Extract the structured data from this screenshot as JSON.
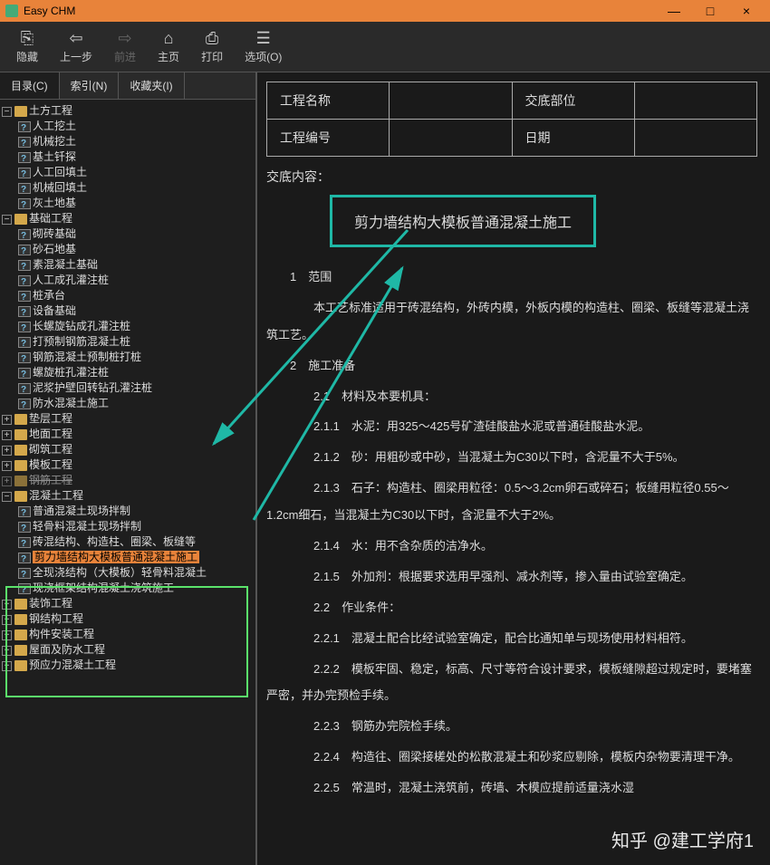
{
  "window": {
    "title": "Easy CHM",
    "min": "—",
    "max": "□",
    "close": "×"
  },
  "toolbar": [
    {
      "id": "hide",
      "label": "隐藏",
      "glyph": "⎘",
      "disabled": false
    },
    {
      "id": "back",
      "label": "上一步",
      "glyph": "⇦",
      "disabled": false
    },
    {
      "id": "fwd",
      "label": "前进",
      "glyph": "⇨",
      "disabled": true
    },
    {
      "id": "home",
      "label": "主页",
      "glyph": "⌂",
      "disabled": false
    },
    {
      "id": "print",
      "label": "打印",
      "glyph": "⎙",
      "disabled": false
    },
    {
      "id": "opts",
      "label": "选项(O)",
      "glyph": "☰",
      "disabled": false
    }
  ],
  "tabs": [
    {
      "id": "contents",
      "label": "目录(C)",
      "active": true
    },
    {
      "id": "index",
      "label": "索引(N)",
      "active": false
    },
    {
      "id": "fav",
      "label": "收藏夹(I)",
      "active": false
    }
  ],
  "tree": [
    {
      "label": "土方工程",
      "open": true,
      "children": [
        {
          "label": "人工挖土"
        },
        {
          "label": "机械挖土"
        },
        {
          "label": "基土钎探"
        },
        {
          "label": "人工回填土"
        },
        {
          "label": "机械回填土"
        },
        {
          "label": "灰土地基"
        }
      ]
    },
    {
      "label": "基础工程",
      "open": true,
      "children": [
        {
          "label": "砌砖基础"
        },
        {
          "label": "砂石地基"
        },
        {
          "label": "素混凝土基础"
        },
        {
          "label": "人工成孔灌注桩"
        },
        {
          "label": "桩承台"
        },
        {
          "label": "设备基础"
        },
        {
          "label": "长螺旋钻成孔灌注桩"
        },
        {
          "label": "打预制钢筋混凝土桩"
        },
        {
          "label": "钢筋混凝土预制桩打桩"
        },
        {
          "label": "螺旋桩孔灌注桩"
        },
        {
          "label": "泥浆护壁回转钻孔灌注桩"
        },
        {
          "label": "防水混凝土施工"
        }
      ]
    },
    {
      "label": "垫层工程",
      "open": false
    },
    {
      "label": "地面工程",
      "open": false
    },
    {
      "label": "砌筑工程",
      "open": false
    },
    {
      "label": "模板工程",
      "open": false
    },
    {
      "label": "钢筋工程",
      "open": false,
      "cut": true
    },
    {
      "label": "混凝土工程",
      "open": true,
      "hl": true,
      "children": [
        {
          "label": "普通混凝土现场拌制"
        },
        {
          "label": "轻骨料混凝土现场拌制"
        },
        {
          "label": "砖混结构、构造柱、圈梁、板缝等"
        },
        {
          "label": "剪力墙结构大模板普通混凝土施工",
          "selected": true
        },
        {
          "label": "全现浇结构（大模板）轻骨料混凝土"
        },
        {
          "label": "现浇框架结构混凝土浇筑施工"
        }
      ]
    },
    {
      "label": "装饰工程",
      "open": false
    },
    {
      "label": "钢结构工程",
      "open": false
    },
    {
      "label": "构件安装工程",
      "open": false
    },
    {
      "label": "屋面及防水工程",
      "open": false
    },
    {
      "label": "预应力混凝土工程",
      "open": false
    }
  ],
  "doc": {
    "header": {
      "r1c1": "工程名称",
      "r1c2": "交底部位",
      "r2c1": "工程编号",
      "r2c2": "日期"
    },
    "section_label": "交底内容：",
    "title": "剪力墙结构大模板普通混凝土施工",
    "body": [
      "1　范围",
      "　　本工艺标准适用于砖混结构，外砖内模，外板内模的构造柱、圈梁、板缝等混凝土浇筑工艺。",
      "2　施工准备",
      "　　2.1　材料及本要机具：",
      "　　2.1.1　水泥：用325～425号矿渣硅酸盐水泥或普通硅酸盐水泥。",
      "　　2.1.2　砂：用粗砂或中砂，当混凝土为C30以下时，含泥量不大于5%。",
      "　　2.1.3　石子：构造柱、圈梁用粒径：0.5～3.2cm卵石或碎石；板缝用粒径0.55～1.2cm细石，当混凝土为C30以下时，含泥量不大于2%。",
      "　　2.1.4　水：用不含杂质的洁净水。",
      "　　2.1.5　外加剂：根据要求选用早强剂、减水剂等，掺入量由试验室确定。",
      "　　2.2　作业条件：",
      "　　2.2.1　混凝土配合比经试验室确定，配合比通知单与现场使用材料相符。",
      "　　2.2.2　模板牢固、稳定，标高、尺寸等符合设计要求，模板缝隙超过规定时，要堵塞严密，并办完预检手续。",
      "　　2.2.3　钢筋办完院检手续。",
      "　　2.2.4　构造往、圈梁接槎处的松散混凝土和砂浆应剔除，模板内杂物要清理干净。",
      "　　2.2.5　常温时，混凝土浇筑前，砖墙、木模应提前适量浇水湿"
    ]
  },
  "watermark": "知乎 @建工学府1"
}
